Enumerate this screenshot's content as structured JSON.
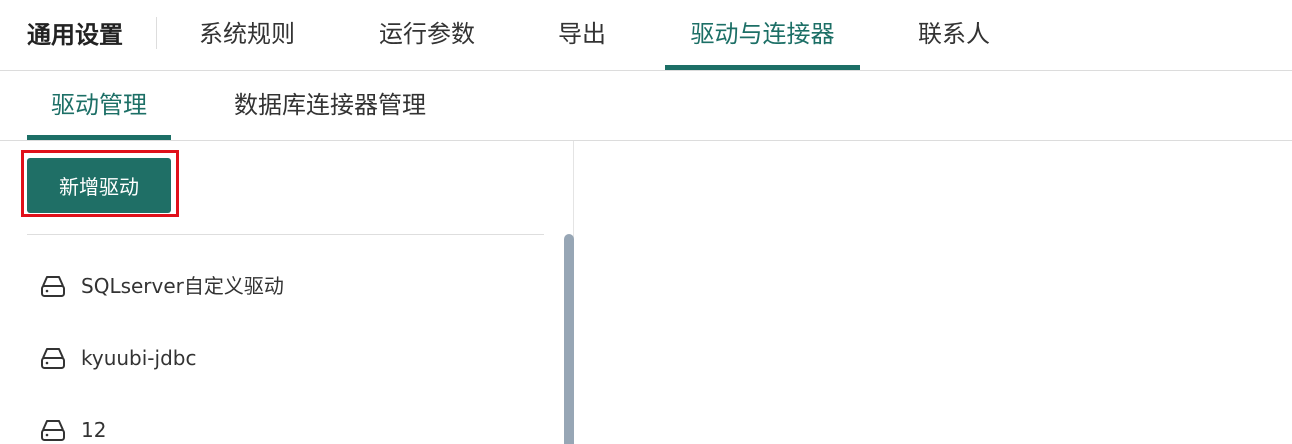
{
  "header": {
    "title": "通用设置",
    "tabs": [
      {
        "label": "系统规则",
        "active": false
      },
      {
        "label": "运行参数",
        "active": false
      },
      {
        "label": "导出",
        "active": false
      },
      {
        "label": "驱动与连接器",
        "active": true
      },
      {
        "label": "联系人",
        "active": false
      }
    ]
  },
  "sub_tabs": [
    {
      "label": "驱动管理",
      "active": true
    },
    {
      "label": "数据库连接器管理",
      "active": false
    }
  ],
  "driver_panel": {
    "add_button_label": "新增驱动",
    "drivers": [
      {
        "label": "SQLserver自定义驱动",
        "icon": "hard-drive-icon"
      },
      {
        "label": "kyuubi-jdbc",
        "icon": "hard-drive-icon"
      },
      {
        "label": "12",
        "icon": "hard-drive-icon"
      }
    ]
  },
  "colors": {
    "accent": "#1c6f66",
    "highlight_border": "#e0101a",
    "scrollbar": "#97a6b5"
  }
}
